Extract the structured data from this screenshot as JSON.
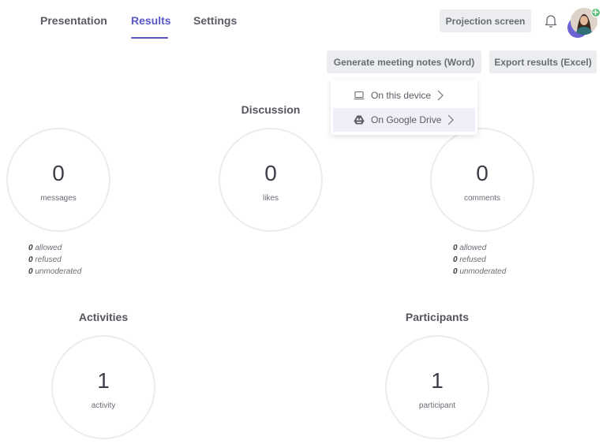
{
  "tabs": [
    {
      "label": "Presentation"
    },
    {
      "label": "Results"
    },
    {
      "label": "Settings"
    }
  ],
  "header": {
    "projection_label": "Projection screen"
  },
  "actions": {
    "meeting_notes_label": "Generate meeting notes (Word)",
    "export_label": "Export results (Excel)"
  },
  "dropdown": {
    "items": [
      {
        "label": "On this device",
        "icon": "laptop-icon"
      },
      {
        "label": "On Google Drive",
        "icon": "google-drive-icon"
      }
    ]
  },
  "discussion": {
    "title": "Discussion",
    "messages": {
      "value": "0",
      "label": "messages"
    },
    "likes": {
      "value": "0",
      "label": "likes"
    },
    "comments": {
      "value": "0",
      "label": "comments"
    },
    "messages_stats": [
      {
        "count": "0",
        "label": "allowed"
      },
      {
        "count": "0",
        "label": "refused"
      },
      {
        "count": "0",
        "label": "unmoderated"
      }
    ],
    "comments_stats": [
      {
        "count": "0",
        "label": "allowed"
      },
      {
        "count": "0",
        "label": "refused"
      },
      {
        "count": "0",
        "label": "unmoderated"
      }
    ]
  },
  "activities": {
    "title": "Activities",
    "value": "1",
    "label": "activity"
  },
  "participants": {
    "title": "Participants",
    "value": "1",
    "label": "participant"
  },
  "colors": {
    "accent": "#5a58c9",
    "button_bg": "#ebedf0",
    "hover_bg": "#efeef9",
    "avatar_status": "#5fbf7a"
  }
}
